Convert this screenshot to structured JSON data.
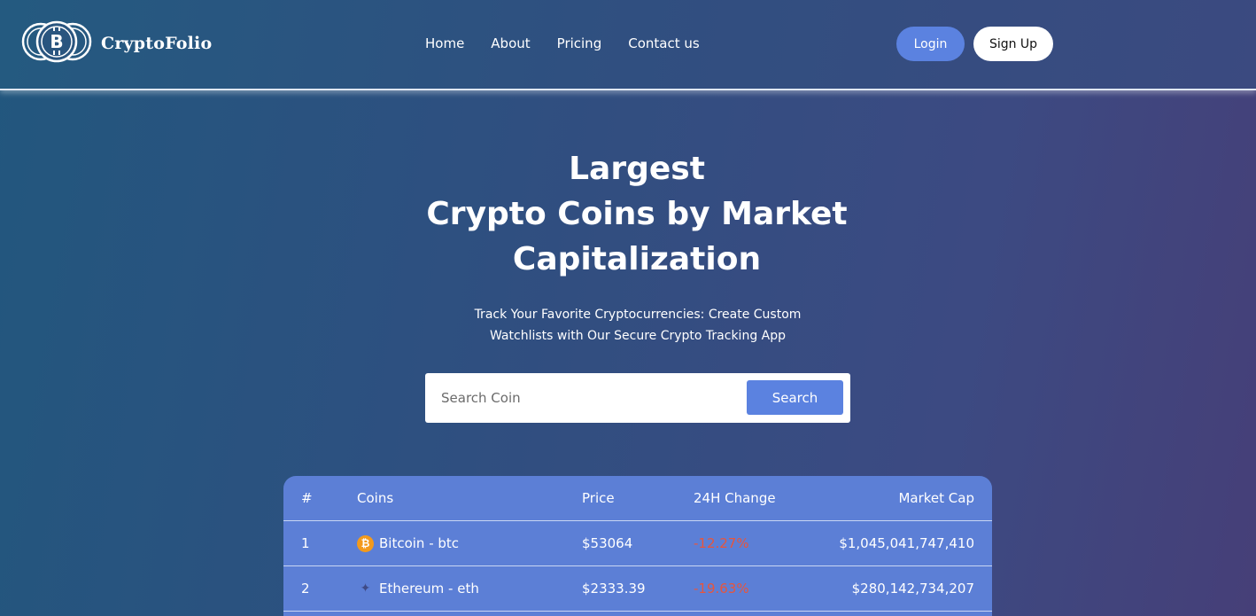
{
  "brand": {
    "name": "CryptoFolio"
  },
  "nav": {
    "items": [
      {
        "label": "Home"
      },
      {
        "label": "About"
      },
      {
        "label": "Pricing"
      },
      {
        "label": "Contact us"
      }
    ]
  },
  "auth": {
    "login_label": "Login",
    "signup_label": "Sign Up"
  },
  "hero": {
    "title_lines": [
      "Largest",
      "Crypto Coins by Market",
      "Capitalization"
    ],
    "subtitle_lines": [
      "Track Your Favorite Cryptocurrencies: Create Custom",
      "Watchlists with Our Secure Crypto Tracking App"
    ]
  },
  "search": {
    "placeholder": "Search Coin",
    "value": "",
    "button_label": "Search"
  },
  "table": {
    "headers": [
      "#",
      "Coins",
      "Price",
      "24H Change",
      "Market Cap"
    ],
    "rows": [
      {
        "rank": "1",
        "coin": "Bitcoin - btc",
        "icon": "bitcoin-icon",
        "price": "$53064",
        "change": "-12.27%",
        "market_cap": "$1,045,041,747,410"
      },
      {
        "rank": "2",
        "coin": "Ethereum - eth",
        "icon": "ethereum-icon",
        "price": "$2333.39",
        "change": "-19.63%",
        "market_cap": "$280,142,734,207"
      }
    ]
  },
  "colors": {
    "accent": "#5b82e0",
    "table_bg": "#5c7fd6",
    "negative": "#e8553c",
    "bitcoin": "#f39a1c"
  }
}
